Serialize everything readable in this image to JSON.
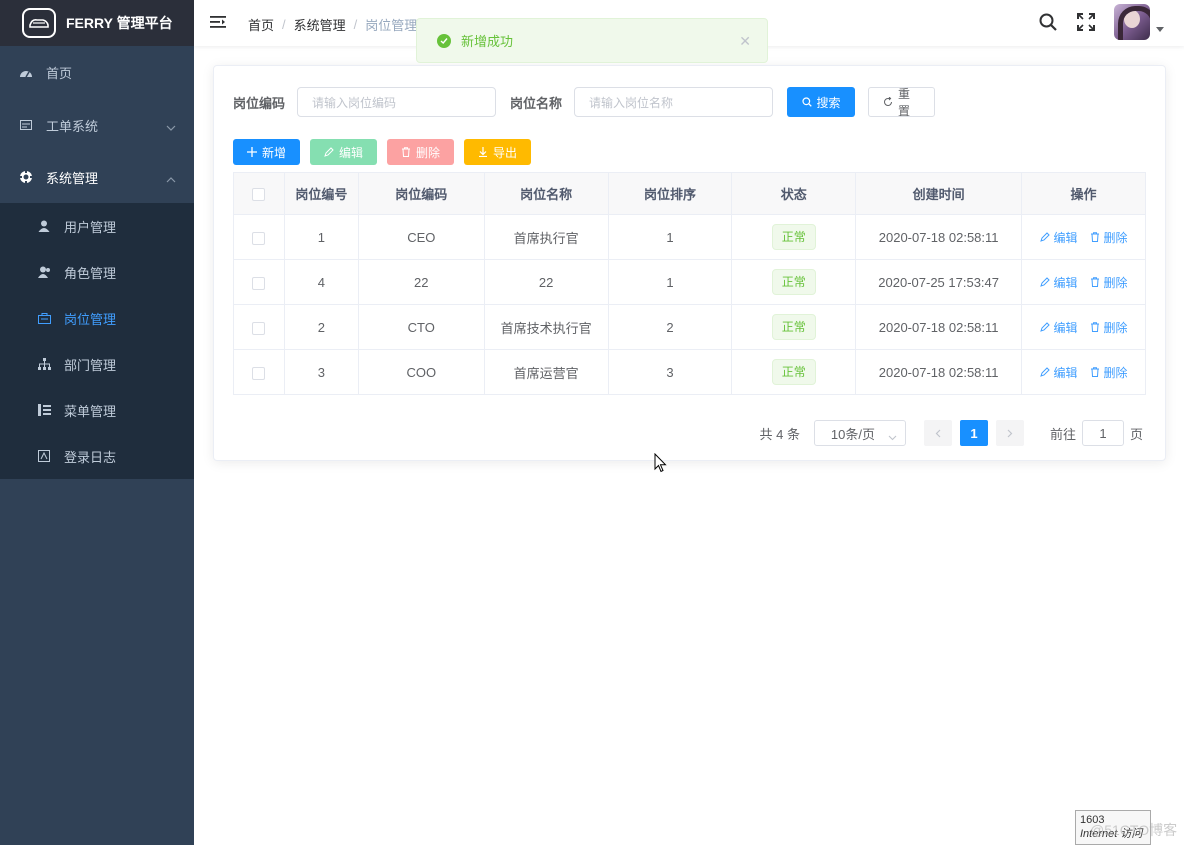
{
  "sidebar": {
    "title": "FERRY 管理平台",
    "menu": [
      {
        "label": "首页",
        "icon": "dashboard-icon"
      },
      {
        "label": "工单系统",
        "icon": "ticket-icon"
      },
      {
        "label": "系统管理",
        "icon": "settings-icon"
      }
    ],
    "submenu": [
      {
        "label": "用户管理",
        "icon": "user-icon"
      },
      {
        "label": "角色管理",
        "icon": "role-icon"
      },
      {
        "label": "岗位管理",
        "icon": "post-icon",
        "active": true
      },
      {
        "label": "部门管理",
        "icon": "tree-icon"
      },
      {
        "label": "菜单管理",
        "icon": "menu-list-icon"
      },
      {
        "label": "登录日志",
        "icon": "log-icon"
      }
    ]
  },
  "breadcrumb": [
    "首页",
    "系统管理",
    "岗位管理"
  ],
  "toast": {
    "message": "新增成功"
  },
  "search": {
    "code_label": "岗位编码",
    "code_placeholder": "请输入岗位编码",
    "name_label": "岗位名称",
    "name_placeholder": "请输入岗位名称",
    "search_btn": "搜索",
    "reset_btn": "重置"
  },
  "toolbar": {
    "add": "新增",
    "edit": "编辑",
    "delete": "删除",
    "export": "导出"
  },
  "table": {
    "headers": [
      "岗位编号",
      "岗位编码",
      "岗位名称",
      "岗位排序",
      "状态",
      "创建时间",
      "操作"
    ],
    "rows": [
      {
        "id": "1",
        "code": "CEO",
        "name": "首席执行官",
        "sort": "1",
        "status": "正常",
        "created": "2020-07-18 02:58:11"
      },
      {
        "id": "4",
        "code": "22",
        "name": "22",
        "sort": "1",
        "status": "正常",
        "created": "2020-07-25 17:53:47"
      },
      {
        "id": "2",
        "code": "CTO",
        "name": "首席技术执行官",
        "sort": "2",
        "status": "正常",
        "created": "2020-07-18 02:58:11"
      },
      {
        "id": "3",
        "code": "COO",
        "name": "首席运营官",
        "sort": "3",
        "status": "正常",
        "created": "2020-07-18 02:58:11"
      }
    ],
    "op_edit": "编辑",
    "op_delete": "删除"
  },
  "pagination": {
    "total": "共 4 条",
    "page_size": "10条/页",
    "current": "1",
    "goto_prefix": "前往",
    "goto_value": "1",
    "goto_suffix": "页"
  },
  "status_box": {
    "line1": "1603",
    "line2": "Internet 访问"
  },
  "watermark": "@51CTO博客",
  "colors": {
    "sidebar": "#304156",
    "primary": "#1890ff",
    "success": "#67c23a",
    "active_menu": "#409eff"
  }
}
